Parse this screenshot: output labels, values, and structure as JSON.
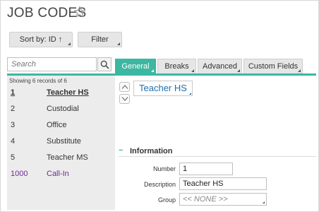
{
  "page": {
    "title": "JOB CODES",
    "star_icon": "star-outline-icon"
  },
  "toolbar": {
    "sort_label": "Sort by: ID ↑",
    "filter_label": "Filter"
  },
  "search": {
    "placeholder": "Search",
    "icon": "search-icon"
  },
  "sidebar": {
    "records_text": "Showing 6 records of 6",
    "items": [
      {
        "id": "1",
        "name": "Teacher HS"
      },
      {
        "id": "2",
        "name": "Custodial"
      },
      {
        "id": "3",
        "name": "Office"
      },
      {
        "id": "4",
        "name": "Substitute"
      },
      {
        "id": "5",
        "name": "Teacher MS"
      },
      {
        "id": "1000",
        "name": "Call-In"
      }
    ]
  },
  "tabs": [
    {
      "label": "General"
    },
    {
      "label": "Breaks"
    },
    {
      "label": "Advanced"
    },
    {
      "label": "Custom Fields"
    }
  ],
  "detail": {
    "record_name": "Teacher HS",
    "section_toggle": "−",
    "section_title": "Information",
    "number_label": "Number",
    "number_value": "1",
    "description_label": "Description",
    "description_value": "Teacher HS",
    "group_label": "Group",
    "group_value": "<< NONE >>"
  },
  "colors": {
    "accent": "#3cb7a1",
    "link": "#1f6fb0",
    "purple_item": "#6b2c91"
  }
}
